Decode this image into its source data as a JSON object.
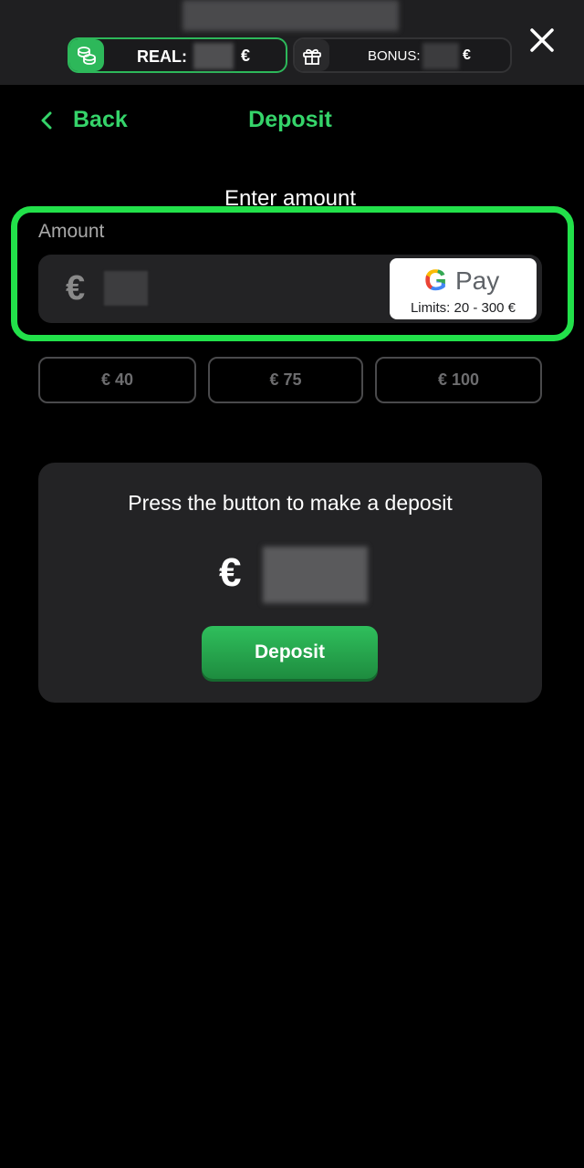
{
  "header": {
    "real_label": "REAL:",
    "real_currency": "€",
    "bonus_label": "BONUS:",
    "bonus_currency": "€",
    "icons": {
      "real": "coins-icon",
      "bonus": "gift-icon",
      "close": "close-icon"
    },
    "accent_color": "#2db85a"
  },
  "nav": {
    "back_label": "Back",
    "title": "Deposit"
  },
  "form": {
    "heading": "Enter amount",
    "amount_label": "Amount",
    "currency_symbol": "€",
    "amount_value": "",
    "payment_method": {
      "g_glyph": "G",
      "pay_text": "Pay",
      "limits": "Limits: 20 - 300 €"
    },
    "presets": [
      "€ 40",
      "€ 75",
      "€ 100"
    ],
    "highlight_color": "#22e14a"
  },
  "summary": {
    "message": "Press the button to make a deposit",
    "currency_symbol": "€",
    "deposit_button": "Deposit"
  }
}
